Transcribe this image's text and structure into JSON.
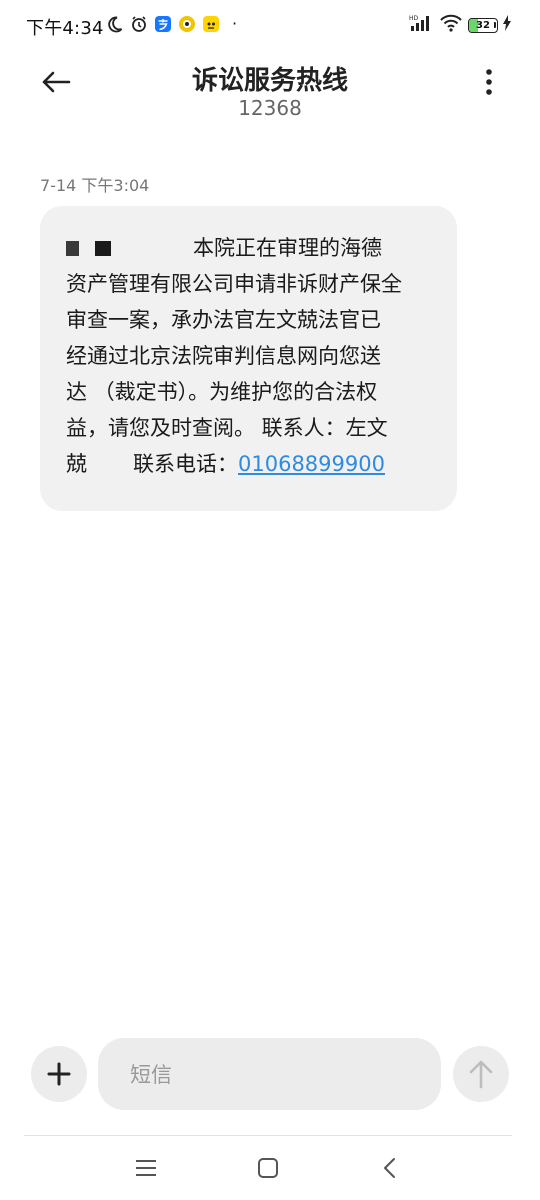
{
  "status_bar": {
    "time": "下午4:34",
    "battery_level": 32,
    "battery_label": "32",
    "network_label": "HD",
    "dot": "·"
  },
  "header": {
    "title": "诉讼服务热线",
    "subtitle": "12368"
  },
  "conversation": {
    "messages": [
      {
        "timestamp": "7-14 下午3:04",
        "lines": [
          "本院正在审理的海德",
          "资产管理有限公司申请非诉财产保全",
          "审查一案，承办法官左文兢法官已",
          "经通过北京法院审判信息网向您送",
          "达 （裁定书）。为维护您的合法权",
          "益，请您及时查阅。 联系人：左文"
        ],
        "last_line_prefix": "兢",
        "contact_label": "联系电话：",
        "phone_number": "01068899900"
      }
    ]
  },
  "composer": {
    "placeholder": "短信"
  },
  "colors": {
    "link": "#2e8be0",
    "bubble": "#f1f1f1",
    "battery_fill": "#6bd66b"
  },
  "icons": {
    "back": "arrow-left-icon",
    "more": "more-vertical-icon",
    "add": "plus-icon",
    "send": "arrow-up-icon",
    "nav_menu": "menu-lines-icon",
    "nav_home": "home-square-icon",
    "nav_back": "chevron-left-icon"
  }
}
